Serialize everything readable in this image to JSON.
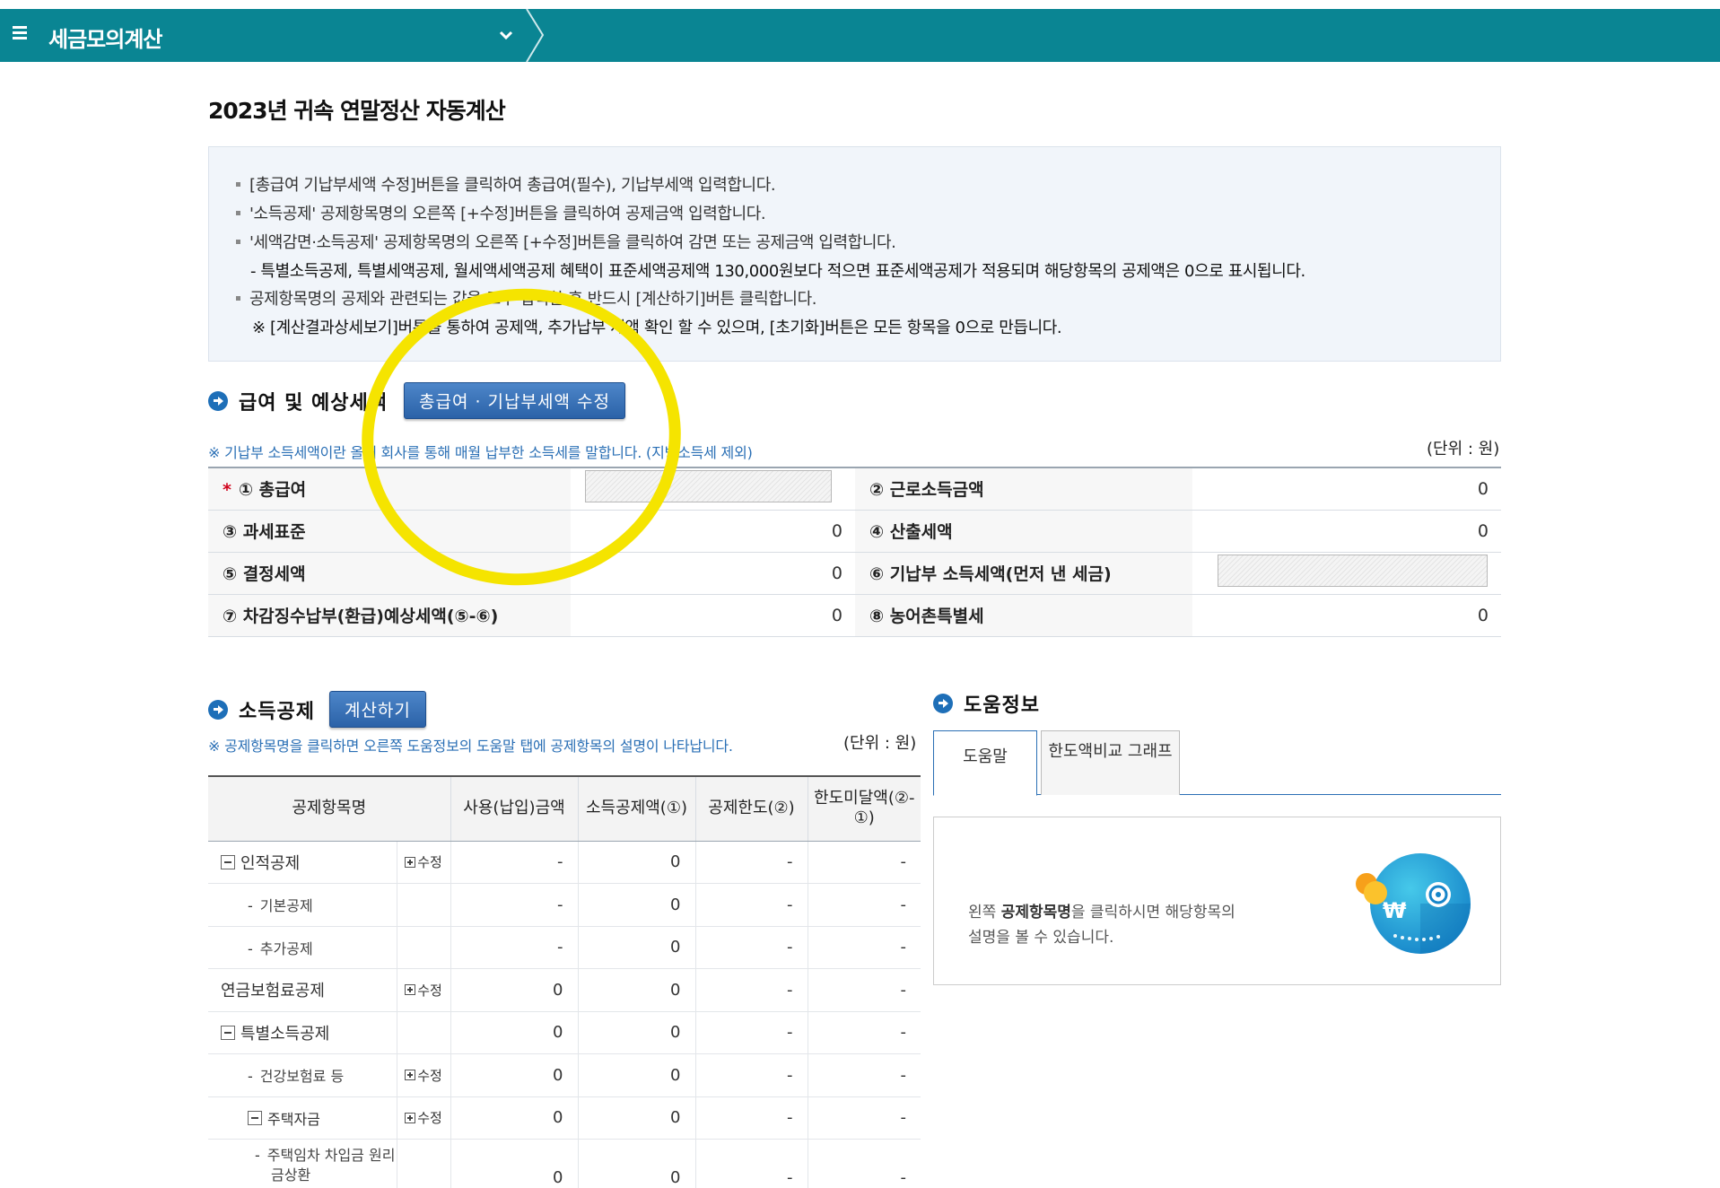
{
  "header": {
    "title": "세금모의계산"
  },
  "page_title": "2023년 귀속 연말정산 자동계산",
  "notice_lines": [
    "[총급여 기납부세액 수정]버튼을 클릭하여 총급여(필수), 기납부세액 입력합니다.",
    "'소득공제' 공제항목명의 오른쪽 [+수정]버튼을 클릭하여 공제금액 입력합니다.",
    "'세액감면·소득공제' 공제항목명의 오른쪽 [+수정]버튼을 클릭하여 감면 또는 공제금액 입력합니다.",
    "- 특별소득공제, 특별세액공제, 월세액세액공제 혜택이 표준세액공제액 130,000원보다 적으면 표준세액공제가 적용되며 해당항목의 공제액은 0으로 표시됩니다.",
    "공제항목명의 공제와 관련되는 값을 모두 입력한 후 반드시 [계산하기]버튼 클릭합니다.",
    "※ [계산결과상세보기]버튼을 통하여 공제액, 추가납부 세액 확인 할 수 있으며, [초기화]버튼은 모든 항목을 0으로 만듭니다."
  ],
  "salary_section": {
    "title": "급여 및 예상세액",
    "edit_button": "총급여 · 기납부세액 수정",
    "note": "※ 기납부 소득세액이란 올해 회사를 통해 매월 납부한 소득세를 말합니다. (지방소득세 제외)",
    "unit": "(단위 : 원)",
    "rows": [
      {
        "l1": "① 총급여",
        "v1": "",
        "l2": "② 근로소득금액",
        "v2": "0"
      },
      {
        "l1": "③ 과세표준",
        "v1": "0",
        "l2": "④ 산출세액",
        "v2": "0"
      },
      {
        "l1": "⑤ 결정세액",
        "v1": "0",
        "l2": "⑥ 기납부 소득세액(먼저 낸 세금)",
        "v2": ""
      },
      {
        "l1": "⑦ 차감징수납부(환급)예상세액(⑤-⑥)",
        "v1": "0",
        "l2": "⑧ 농어촌특별세",
        "v2": "0"
      }
    ]
  },
  "deduction_section": {
    "title": "소득공제",
    "calc_button": "계산하기",
    "note": "※ 공제항목명을 클릭하면 오른쪽 도움정보의 도움말 탭에 공제항목의 설명이 나타납니다.",
    "unit": "(단위 : 원)",
    "columns": [
      "공제항목명",
      "사용(납입)금액",
      "소득공제액(①)",
      "공제한도(②)",
      "한도미달액(②-①)"
    ],
    "edit_label": "수정",
    "rows": [
      {
        "name": "인적공제",
        "edit": true,
        "used": "-",
        "ded": "0",
        "limit": "-",
        "short": "-"
      },
      {
        "name": "기본공제",
        "edit": false,
        "used": "-",
        "ded": "0",
        "limit": "-",
        "short": "-"
      },
      {
        "name": "추가공제",
        "edit": false,
        "used": "-",
        "ded": "0",
        "limit": "-",
        "short": "-"
      },
      {
        "name": "연금보험료공제",
        "edit": true,
        "used": "0",
        "ded": "0",
        "limit": "-",
        "short": "-"
      },
      {
        "name": "특별소득공제",
        "edit": false,
        "used": "0",
        "ded": "0",
        "limit": "-",
        "short": "-"
      },
      {
        "name": "건강보험료 등",
        "edit": true,
        "used": "0",
        "ded": "0",
        "limit": "-",
        "short": "-"
      },
      {
        "name": "주택자금",
        "edit": true,
        "used": "0",
        "ded": "0",
        "limit": "-",
        "short": "-"
      },
      {
        "name": "주택임차 차입금 원리금상환",
        "edit": false,
        "used": "0",
        "ded": "0",
        "limit": "-",
        "short": "-"
      }
    ]
  },
  "help_section": {
    "title": "도움정보",
    "tabs": [
      "도움말",
      "한도액비교 그래프"
    ],
    "text_prefix": "왼쪽 ",
    "text_bold": "공제항목명",
    "text_suffix": "을 클릭하시면 해당항목의",
    "text_line2": "설명을 볼 수 있습니다.",
    "emblem_symbol": "₩"
  },
  "colors": {
    "header_bg": "#0a8593",
    "accent_blue": "#2a6fb5",
    "highlight": "#f5e400"
  }
}
